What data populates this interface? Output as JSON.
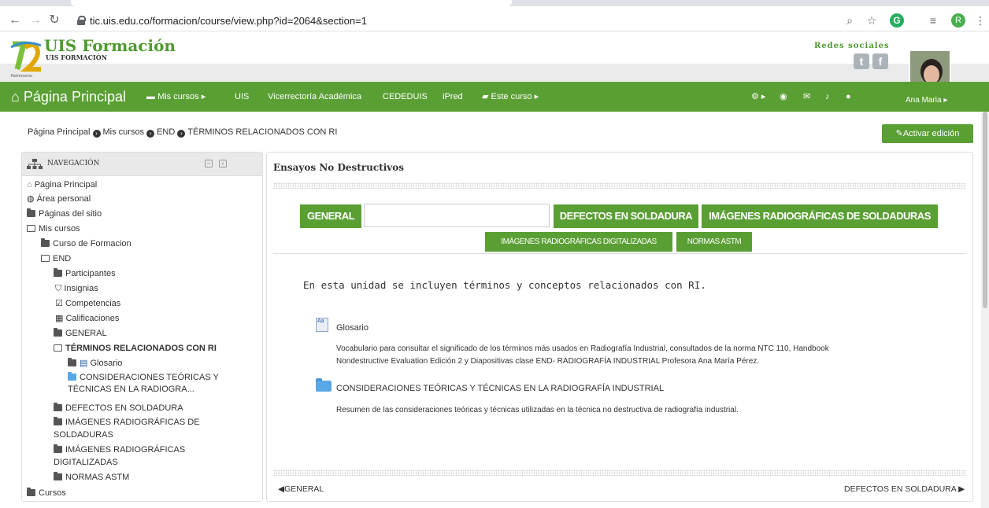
{
  "browser": {
    "url": "tic.uis.edu.co/formacion/course/view.php?id=2064&section=1",
    "profile_initial": "R",
    "extension_initial": "G"
  },
  "site": {
    "brand_title": "UIS Formación",
    "brand_subtitle": "UIS FORMACIÓN",
    "logo_text": "Patrimonio",
    "social_label": "Redes sociales"
  },
  "topnav": {
    "home": "Página Principal",
    "items": [
      "Mis cursos",
      "UIS",
      "Vicerrectoría Académica",
      "CEDEDUIS",
      "iPred",
      "Este curso"
    ],
    "user": "Ana Maria"
  },
  "breadcrumb": [
    "Página Principal",
    "Mis cursos",
    "END",
    "TÉRMINOS RELACIONADOS CON RI"
  ],
  "edit_button": "Activar edición",
  "navigation": {
    "title": "NAVEGACIÓN",
    "items": [
      "Página Principal",
      "Área personal",
      "Páginas del sitio",
      "Mis cursos",
      "Curso de Formacion",
      "END",
      "Participantes",
      "Insignias",
      "Competencias",
      "Calificaciones",
      "GENERAL",
      "TÉRMINOS RELACIONADOS CON RI",
      "Glosario",
      "CONSIDERACIONES TEÓRICAS Y",
      "TÉCNICAS EN LA RADIOGRA...",
      "DEFECTOS EN SOLDADURA",
      "IMÁGENES RADIOGRÁFICAS DE",
      "SOLDADURAS",
      "IMÁGENES RADIOGRÁFICAS",
      "DIGITALIZADAS",
      "NORMAS ASTM",
      "Cursos"
    ]
  },
  "course": {
    "title": "Ensayos No Destructivos",
    "tabs_row1": [
      "GENERAL",
      "",
      "DEFECTOS EN SOLDADURA",
      "IMÁGENES RADIOGRÁFICAS DE SOLDADURAS"
    ],
    "tabs_row2": [
      "IMÁGENES RADIOGRÁFICAS DIGITALIZADAS",
      "NORMAS ASTM"
    ],
    "summary": "En esta unidad se incluyen términos y conceptos relacionados con RI.",
    "activities": [
      {
        "name": "Glosario",
        "icon_text": "Aa",
        "desc_line1": "Vocabulario para consultar el significado de los términos más usados en Radiografía Industrial, consultados de la norma NTC 110, Handbook",
        "desc_line2": "Nondestructive Evaluation Edición 2 y Diapositivas clase END- RADIOGRAFÍA INDUSTRIAL Profesora Ana María Pérez."
      },
      {
        "name": "CONSIDERACIONES TEÓRICAS Y TÉCNICAS EN LA RADIOGRAFÍA INDUSTRIAL",
        "desc_line1": "Resumen de las consideraciones teóricas y técnicas utilizadas en la técnica no destructiva de radiografía industrial."
      }
    ],
    "prev": "GENERAL",
    "next": "DEFECTOS EN SOLDADURA"
  }
}
